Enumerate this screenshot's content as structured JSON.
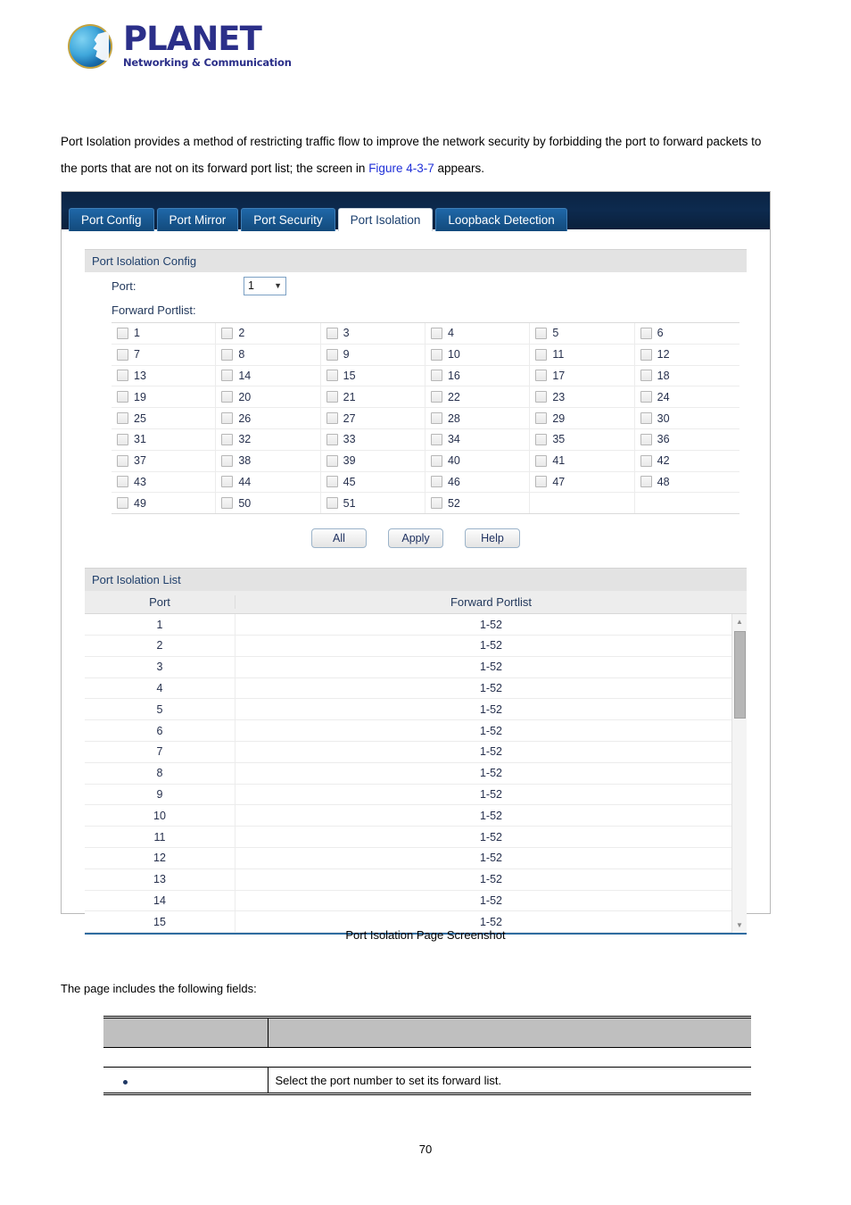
{
  "logo": {
    "brand": "PLANET",
    "tagline": "Networking & Communication",
    "icon": "planet-globe-icon"
  },
  "intro": {
    "part1": "Port Isolation provides a method of restricting traffic flow to improve the network security by forbidding the port to forward packets to the ports that are not on its forward port list; the screen in ",
    "figure_link": "Figure 4-3-7",
    "part2": " appears."
  },
  "screenshot": {
    "tabs": [
      {
        "label": "Port Config",
        "active": false
      },
      {
        "label": "Port Mirror",
        "active": false
      },
      {
        "label": "Port Security",
        "active": false
      },
      {
        "label": "Port Isolation",
        "active": true
      },
      {
        "label": "Loopback Detection",
        "active": false
      }
    ],
    "config": {
      "section_title": "Port Isolation Config",
      "port_label": "Port:",
      "port_value": "1",
      "port_options": [
        "1"
      ],
      "forward_portlist_label": "Forward Portlist:",
      "ports": [
        [
          "1",
          "2",
          "3",
          "4",
          "5",
          "6"
        ],
        [
          "7",
          "8",
          "9",
          "10",
          "11",
          "12"
        ],
        [
          "13",
          "14",
          "15",
          "16",
          "17",
          "18"
        ],
        [
          "19",
          "20",
          "21",
          "22",
          "23",
          "24"
        ],
        [
          "25",
          "26",
          "27",
          "28",
          "29",
          "30"
        ],
        [
          "31",
          "32",
          "33",
          "34",
          "35",
          "36"
        ],
        [
          "37",
          "38",
          "39",
          "40",
          "41",
          "42"
        ],
        [
          "43",
          "44",
          "45",
          "46",
          "47",
          "48"
        ],
        [
          "49",
          "50",
          "51",
          "52",
          "",
          ""
        ]
      ],
      "buttons": {
        "all": "All",
        "apply": "Apply",
        "help": "Help"
      }
    },
    "list": {
      "section_title": "Port Isolation List",
      "columns": [
        "Port",
        "Forward Portlist"
      ],
      "rows": [
        {
          "port": "1",
          "forward": "1-52"
        },
        {
          "port": "2",
          "forward": "1-52"
        },
        {
          "port": "3",
          "forward": "1-52"
        },
        {
          "port": "4",
          "forward": "1-52"
        },
        {
          "port": "5",
          "forward": "1-52"
        },
        {
          "port": "6",
          "forward": "1-52"
        },
        {
          "port": "7",
          "forward": "1-52"
        },
        {
          "port": "8",
          "forward": "1-52"
        },
        {
          "port": "9",
          "forward": "1-52"
        },
        {
          "port": "10",
          "forward": "1-52"
        },
        {
          "port": "11",
          "forward": "1-52"
        },
        {
          "port": "12",
          "forward": "1-52"
        },
        {
          "port": "13",
          "forward": "1-52"
        },
        {
          "port": "14",
          "forward": "1-52"
        },
        {
          "port": "15",
          "forward": "1-52"
        }
      ]
    }
  },
  "caption": "Port Isolation Page Screenshot",
  "fields_intro": "The page includes the following fields:",
  "fields_table": {
    "header": {
      "col1": "",
      "col2": ""
    },
    "rows": [
      {
        "name": "",
        "description": "Select the port number to set its forward list."
      }
    ]
  },
  "page_number": "70",
  "colors": {
    "brand_blue": "#2b2f89",
    "tab_active_bg": "#ffffff",
    "tab_bg": "#18578f",
    "tabbar_bg": "#0d2a4e",
    "section_header_bg": "#e3e3e3",
    "link_blue": "#2030d8",
    "table_underline": "#2e6ba0"
  }
}
